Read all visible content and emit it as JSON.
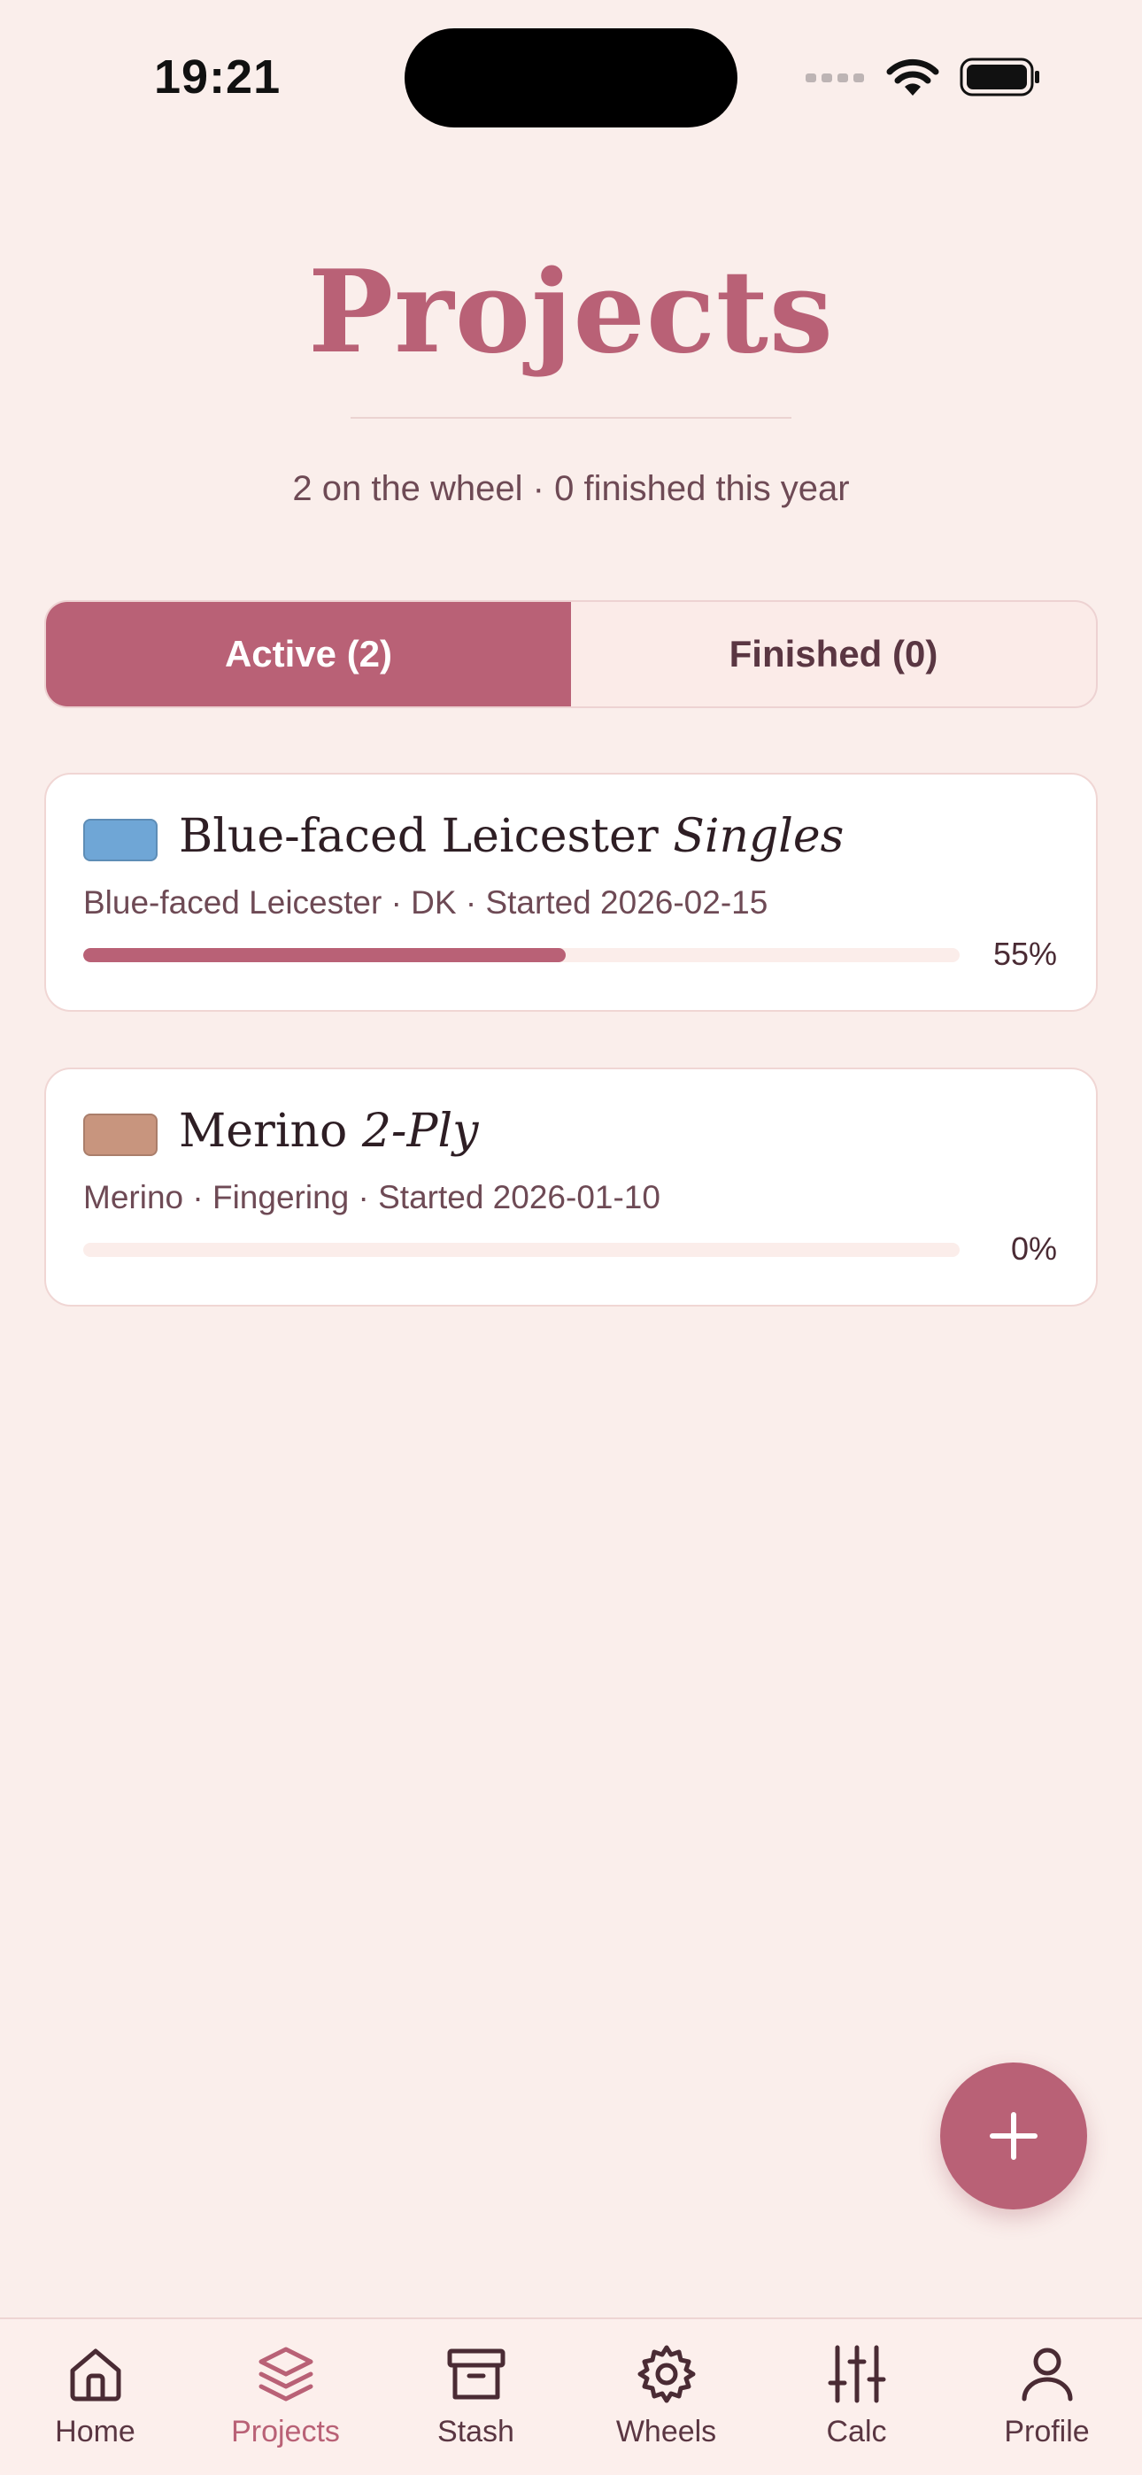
{
  "status_bar": {
    "time": "19:21"
  },
  "header": {
    "title": "Projects",
    "subtitle": "2 on the wheel · 0 finished this year"
  },
  "segments": [
    {
      "label": "Active (2)",
      "selected": true
    },
    {
      "label": "Finished (0)",
      "selected": false
    }
  ],
  "projects": [
    {
      "name": "Blue-faced Leicester",
      "style": "Singles",
      "meta": "Blue-faced Leicester · DK · Started 2026-02-15",
      "progress": 0.55,
      "progress_label": "55%",
      "color": "#6FA6D6"
    },
    {
      "name": "Merino",
      "style": "2-Ply",
      "meta": "Merino · Fingering · Started 2026-01-10",
      "progress": 0.0,
      "progress_label": "0%",
      "color": "#C8957E"
    }
  ],
  "fab": {
    "icon": "plus-icon"
  },
  "tabbar": {
    "items": [
      {
        "label": "Home",
        "icon": "home-icon",
        "active": false
      },
      {
        "label": "Projects",
        "icon": "layers-icon",
        "active": true
      },
      {
        "label": "Stash",
        "icon": "archive-box-icon",
        "active": false
      },
      {
        "label": "Wheels",
        "icon": "gear-icon",
        "active": false
      },
      {
        "label": "Calc",
        "icon": "sliders-icon",
        "active": false
      },
      {
        "label": "Profile",
        "icon": "user-icon",
        "active": false
      }
    ]
  },
  "colors": {
    "accent": "#B96176",
    "background": "#FAEEEB",
    "text": "#4A2B34"
  }
}
